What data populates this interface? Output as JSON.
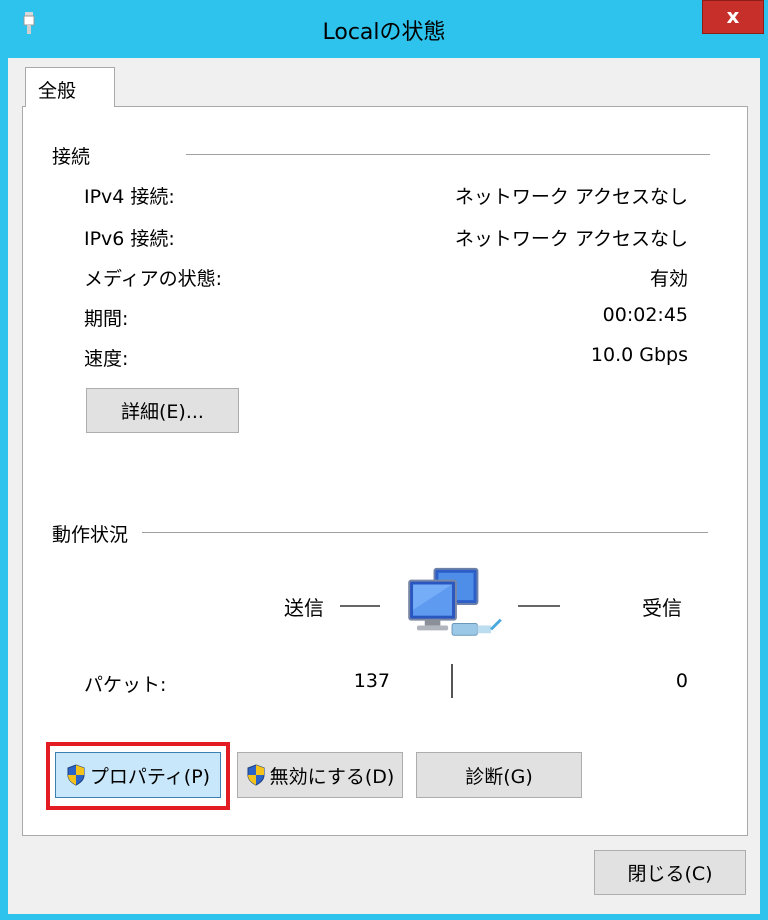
{
  "window": {
    "title": "Localの状態",
    "close_label": "x"
  },
  "tabs": [
    {
      "label": "全般"
    }
  ],
  "connection": {
    "section_title": "接続",
    "rows": [
      {
        "label": "IPv4 接続:",
        "value": "ネットワーク アクセスなし"
      },
      {
        "label": "IPv6 接続:",
        "value": "ネットワーク アクセスなし"
      },
      {
        "label": "メディアの状態:",
        "value": "有効"
      },
      {
        "label": "期間:",
        "value": "00:02:45"
      },
      {
        "label": "速度:",
        "value": "10.0 Gbps"
      }
    ],
    "details_button": "詳細(E)..."
  },
  "activity": {
    "section_title": "動作状況",
    "sent_label": "送信",
    "received_label": "受信",
    "packets_label": "パケット:",
    "packets_sent": "137",
    "packets_received": "0"
  },
  "actions": {
    "properties_button": "プロパティ(P)",
    "disable_button": "無効にする(D)",
    "diagnose_button": "診断(G)"
  },
  "footer": {
    "close_button": "閉じる(C)"
  },
  "colors": {
    "titlebar": "#2dc3ec",
    "close": "#c7302a",
    "highlight": "#e31b23"
  }
}
